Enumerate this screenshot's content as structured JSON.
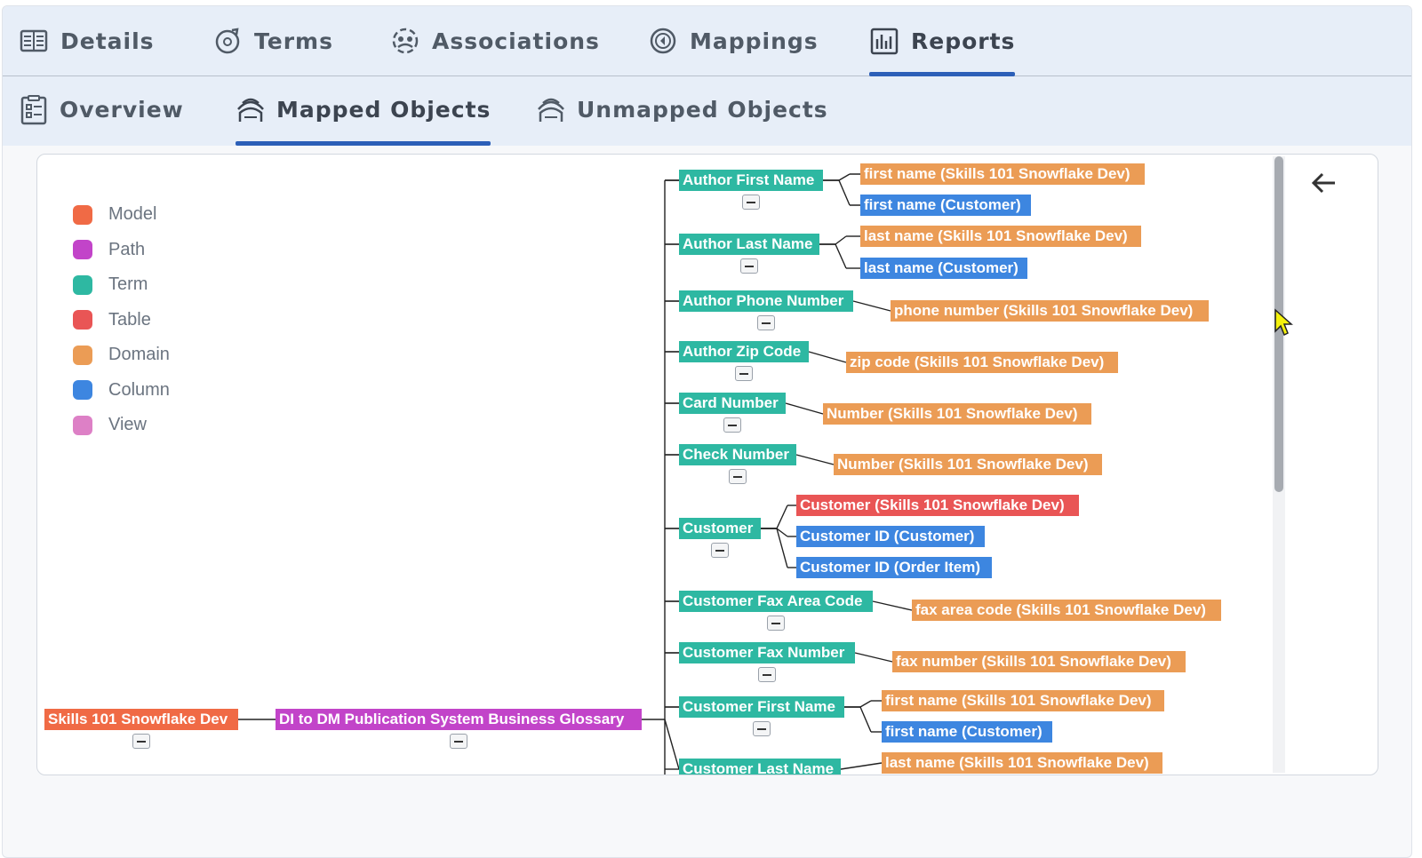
{
  "tabs": [
    {
      "label": "Details",
      "icon": "details-icon",
      "active": false
    },
    {
      "label": "Terms",
      "icon": "terms-icon",
      "active": false
    },
    {
      "label": "Associations",
      "icon": "associations-icon",
      "active": false
    },
    {
      "label": "Mappings",
      "icon": "mappings-icon",
      "active": false
    },
    {
      "label": "Reports",
      "icon": "reports-icon",
      "active": true
    }
  ],
  "subtabs": [
    {
      "label": "Overview",
      "icon": "overview-icon",
      "active": false
    },
    {
      "label": "Mapped Objects",
      "icon": "mapped-objects-icon",
      "active": true
    },
    {
      "label": "Unmapped Objects",
      "icon": "unmapped-objects-icon",
      "active": false
    }
  ],
  "colors": {
    "accent": "#2c5fb8",
    "model": "#f06a45",
    "path": "#c244c9",
    "term": "#2eb8a2",
    "table": "#e95555",
    "domain": "#eb9c55",
    "column": "#3d86e0",
    "view": "#dd80c6"
  },
  "legend": [
    {
      "label": "Model",
      "color": "#f06a45"
    },
    {
      "label": "Path",
      "color": "#c244c9"
    },
    {
      "label": "Term",
      "color": "#2eb8a2"
    },
    {
      "label": "Table",
      "color": "#e95555"
    },
    {
      "label": "Domain",
      "color": "#eb9c55"
    },
    {
      "label": "Column",
      "color": "#3d86e0"
    },
    {
      "label": "View",
      "color": "#dd80c6"
    }
  ],
  "tree": {
    "root": {
      "label": "Skills 101 Snowflake Dev",
      "type": "model"
    },
    "path": {
      "label": "DI to DM Publication System Business Glossary",
      "type": "path"
    },
    "terms": [
      {
        "label": "Author First Name",
        "children": [
          {
            "label": "first name (Skills 101 Snowflake Dev)",
            "type": "domain"
          },
          {
            "label": "first name (Customer)",
            "type": "column"
          }
        ]
      },
      {
        "label": "Author Last Name",
        "children": [
          {
            "label": "last name (Skills 101 Snowflake Dev)",
            "type": "domain"
          },
          {
            "label": "last name (Customer)",
            "type": "column"
          }
        ]
      },
      {
        "label": "Author Phone Number",
        "children": [
          {
            "label": "phone number (Skills 101 Snowflake Dev)",
            "type": "domain"
          }
        ]
      },
      {
        "label": "Author Zip Code",
        "children": [
          {
            "label": "zip code (Skills 101 Snowflake Dev)",
            "type": "domain"
          }
        ]
      },
      {
        "label": "Card Number",
        "children": [
          {
            "label": "Number (Skills 101 Snowflake Dev)",
            "type": "domain"
          }
        ]
      },
      {
        "label": "Check Number",
        "children": [
          {
            "label": "Number (Skills 101 Snowflake Dev)",
            "type": "domain"
          }
        ]
      },
      {
        "label": "Customer",
        "children": [
          {
            "label": "Customer (Skills 101 Snowflake Dev)",
            "type": "table"
          },
          {
            "label": "Customer ID (Customer)",
            "type": "column"
          },
          {
            "label": "Customer ID (Order Item)",
            "type": "column"
          }
        ]
      },
      {
        "label": "Customer Fax Area Code",
        "children": [
          {
            "label": "fax area code (Skills 101 Snowflake Dev)",
            "type": "domain"
          }
        ]
      },
      {
        "label": "Customer Fax Number",
        "children": [
          {
            "label": "fax number (Skills 101 Snowflake Dev)",
            "type": "domain"
          }
        ]
      },
      {
        "label": "Customer First Name",
        "children": [
          {
            "label": "first name (Skills 101 Snowflake Dev)",
            "type": "domain"
          },
          {
            "label": "first name (Customer)",
            "type": "column"
          }
        ]
      },
      {
        "label": "Customer Last Name",
        "children": [
          {
            "label": "last name (Skills 101 Snowflake Dev)",
            "type": "domain"
          }
        ]
      }
    ]
  }
}
